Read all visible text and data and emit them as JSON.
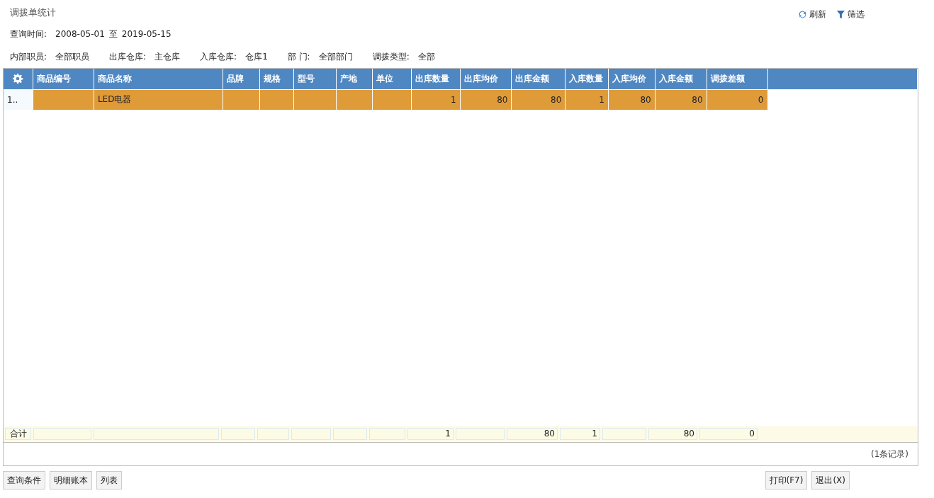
{
  "title": "调拨单统计",
  "toolbar": [
    {
      "kind": "refresh",
      "label": "刷新"
    },
    {
      "kind": "filter",
      "label": "筛选"
    }
  ],
  "query_time": {
    "label": "查询时间:",
    "from": "2008-05-01",
    "separator": "至",
    "to": "2019-05-15"
  },
  "filters": [
    {
      "label": "内部职员:",
      "value": "全部职员"
    },
    {
      "label": "出库仓库:",
      "value": "主仓库"
    },
    {
      "label": "入库仓库:",
      "value": "仓库1"
    },
    {
      "label": "部 门:",
      "value": "全部部门"
    },
    {
      "label": "调拨类型:",
      "value": "全部"
    }
  ],
  "table": {
    "columns": [
      "商品编号",
      "商品名称",
      "品牌",
      "规格",
      "型号",
      "产地",
      "单位",
      "出库数量",
      "出库均价",
      "出库金额",
      "入库数量",
      "入库均价",
      "入库金额",
      "调拨差额"
    ],
    "rows": [
      {
        "row_number": "1..",
        "selected": true,
        "cells": [
          null,
          "LED电器",
          null,
          null,
          null,
          null,
          null,
          "1",
          "80",
          "80",
          "1",
          "80",
          "80",
          "0"
        ]
      }
    ],
    "totals": {
      "label": "合计",
      "cells": [
        null,
        null,
        null,
        null,
        null,
        null,
        null,
        "1",
        null,
        "80",
        "1",
        null,
        "80",
        "0"
      ]
    },
    "record_count": "(1条记录)"
  },
  "left_buttons": [
    "查询条件",
    "明细账本",
    "列表"
  ],
  "right_buttons": [
    "打印(F7)",
    "退出(X)"
  ]
}
